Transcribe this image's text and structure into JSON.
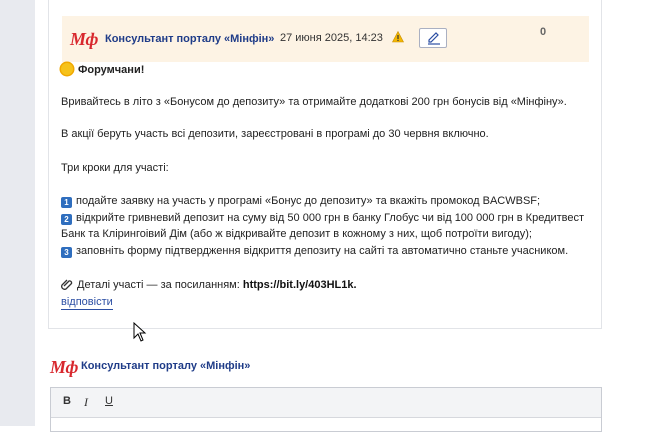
{
  "post": {
    "logo_text": "Мф",
    "author": "Консультант порталу «Мінфін»",
    "datetime": "27 июня 2025, 14:23",
    "score": "0",
    "greeting": "Форумчани!",
    "p1": "Вривайтесь в літо з «Бонусом до депозиту» та отримайте додаткові 200 грн бонусів від «Мінфіну».",
    "p2": "В акції беруть участь всі депозити, зареєстровані в програмі до 30 червня включно.",
    "p3": "Три кроки для участі:",
    "steps": [
      {
        "num": "1",
        "text": "подайте заявку на участь у програмі «Бонус до депозиту» та вкажіть промокод BACWBSF;"
      },
      {
        "num": "2",
        "text": "відкрийте гривневий депозит на суму від 50 000 грн в банку Глобус чи від 100 000 грн в Кредитвест"
      },
      {
        "num": "",
        "text": "Банк та Клірингоівий Дім (або ж відкривайте депозит в кожному з них, щоб потроїти вигоду);"
      },
      {
        "num": "3",
        "text": "заповніть форму підтвердження відкриття депозиту на сайті та автоматично станьте учасником."
      }
    ],
    "details_prefix": "Деталі участі — за посиланням: ",
    "details_link": "https://bit.ly/403HL1k",
    "details_suffix": ".",
    "reply_label": "відповісти"
  },
  "reply_form": {
    "logo_text": "Мф",
    "author": "Консультант порталу «Мінфін»",
    "toolbar": {
      "bold": "B",
      "italic": "I",
      "underline": "U"
    }
  },
  "icons": {
    "warning": "warning-icon",
    "edit": "pencil-icon",
    "sun": "sun-icon",
    "paperclip": "paperclip-icon",
    "cursor": "mouse-pointer-icon"
  },
  "colors": {
    "brand_red": "#d8282e",
    "author_blue": "#1f3c88",
    "header_bg": "#fdf3e4",
    "link_blue": "#2b4ea3",
    "step_badge": "#2f6ebe"
  }
}
